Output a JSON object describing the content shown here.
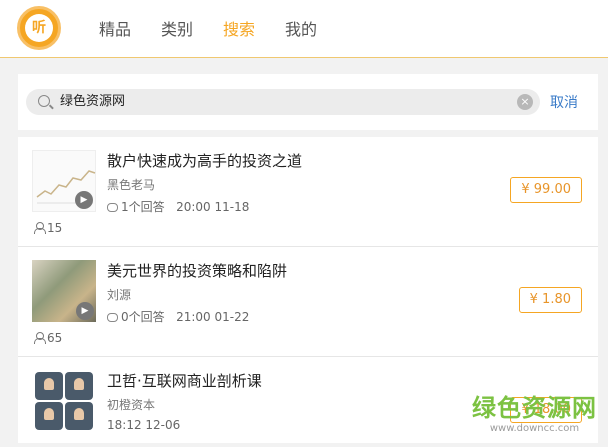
{
  "logo": {
    "text": "听"
  },
  "nav": [
    {
      "label": "精品",
      "active": false
    },
    {
      "label": "类别",
      "active": false
    },
    {
      "label": "搜索",
      "active": true
    },
    {
      "label": "我的",
      "active": false
    }
  ],
  "search": {
    "value": "绿色资源网",
    "clear": "×",
    "cancel": "取消"
  },
  "results": [
    {
      "title": "散户快速成为高手的投资之道",
      "author": "黑色老马",
      "answers": "1个回答",
      "time": "20:00 11-18",
      "listeners": "15",
      "price": "¥ 99.00"
    },
    {
      "title": "美元世界的投资策略和陷阱",
      "author": "刘源",
      "answers": "0个回答",
      "time": "21:00 01-22",
      "listeners": "65",
      "price": "¥ 1.80"
    },
    {
      "title": "卫哲·互联网商业剖析课",
      "author": "初橙资本",
      "time": "18:12 12-06",
      "price": "¥ 18.00"
    }
  ],
  "watermark": {
    "name": "绿色资源网",
    "url": "www.downcc.com"
  },
  "colors": {
    "accent": "#f5a623",
    "link": "#3a7bc8"
  }
}
